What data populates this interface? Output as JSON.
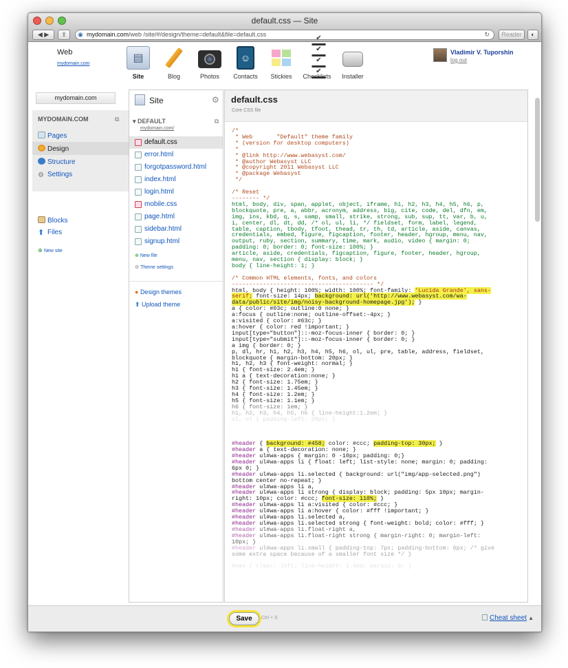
{
  "window": {
    "title": "default.css — Site"
  },
  "browser": {
    "url_domain": "mydomain.com",
    "url_path": "/web          /site/#/design/theme=default&file=default.css",
    "reader_label": "Reader"
  },
  "header": {
    "site_name": "Web",
    "site_link": "mydomain.com",
    "user_name": "Vladimir V. Tuporshin",
    "logout_label": "log out"
  },
  "apps": [
    {
      "label": "Site",
      "icon": "site-icon"
    },
    {
      "label": "Blog",
      "icon": "pencil-icon"
    },
    {
      "label": "Photos",
      "icon": "camera-icon"
    },
    {
      "label": "Contacts",
      "icon": "contacts-icon"
    },
    {
      "label": "Stickies",
      "icon": "stickies-icon"
    },
    {
      "label": "Checklists",
      "icon": "checklist-icon"
    },
    {
      "label": "Installer",
      "icon": "installer-icon"
    }
  ],
  "leftnav": {
    "domain_button": "mydomain.com",
    "section_title": "MYDOMAIN.COM",
    "items": [
      {
        "label": "Pages",
        "icon": "pages-icon"
      },
      {
        "label": "Design",
        "icon": "design-icon"
      },
      {
        "label": "Structure",
        "icon": "structure-icon"
      },
      {
        "label": "Settings",
        "icon": "gear-icon"
      }
    ],
    "extra": [
      {
        "label": "Blocks",
        "icon": "blocks-icon"
      },
      {
        "label": "Files",
        "icon": "upload-icon"
      }
    ],
    "new_site": "New site"
  },
  "mid": {
    "title": "Site",
    "theme_title": "DEFAULT",
    "theme_domain": "mydomain.com/",
    "files": [
      "default.css",
      "error.html",
      "forgotpassword.html",
      "index.html",
      "login.html",
      "mobile.css",
      "page.html",
      "sidebar.html",
      "signup.html"
    ],
    "new_file": "New file",
    "theme_settings": "Theme settings",
    "design_themes": "Design themes",
    "upload_theme": "Upload theme"
  },
  "editor": {
    "filename": "default.css",
    "subtitle": "Core CSS file"
  },
  "bottom": {
    "save_label": "Save",
    "shortcut": "Ctrl + S",
    "cheat_sheet": "Cheat sheet"
  }
}
